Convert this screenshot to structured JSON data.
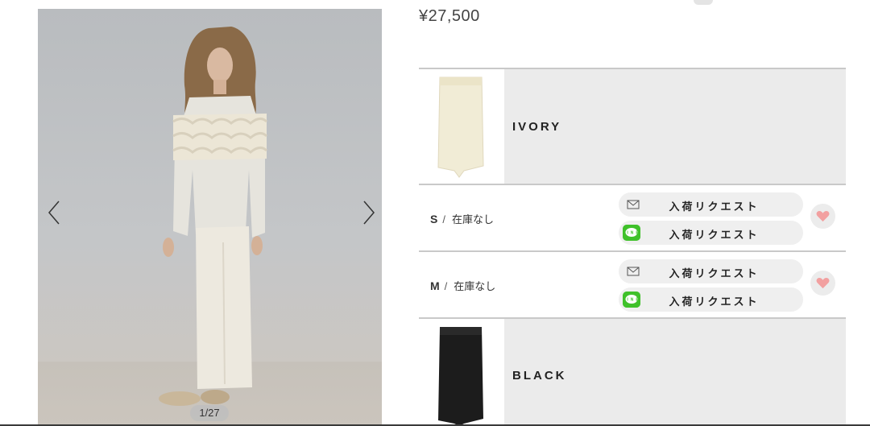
{
  "gallery": {
    "counter": "1/27",
    "prev_icon": "chevron-left-icon",
    "next_icon": "chevron-right-icon"
  },
  "product": {
    "price": "¥27,500"
  },
  "colors": [
    {
      "name": "IVORY",
      "swatch_color": "#f1ecd6",
      "sizes": [
        {
          "size": "S",
          "separator": "/",
          "stock": "在庫なし",
          "mail_request": "入荷リクエスト",
          "line_request": "入荷リクエスト",
          "fav_icon": "heart-icon"
        },
        {
          "size": "M",
          "separator": "/",
          "stock": "在庫なし",
          "mail_request": "入荷リクエスト",
          "line_request": "入荷リクエスト",
          "fav_icon": "heart-icon"
        }
      ]
    },
    {
      "name": "BLACK",
      "swatch_color": "#1c1c1c"
    }
  ],
  "theme": {
    "line_green": "#3fc12a",
    "heart_pink": "#f2a0a0",
    "button_bg": "#efefef",
    "swatch_bg": "#ebebeb"
  }
}
